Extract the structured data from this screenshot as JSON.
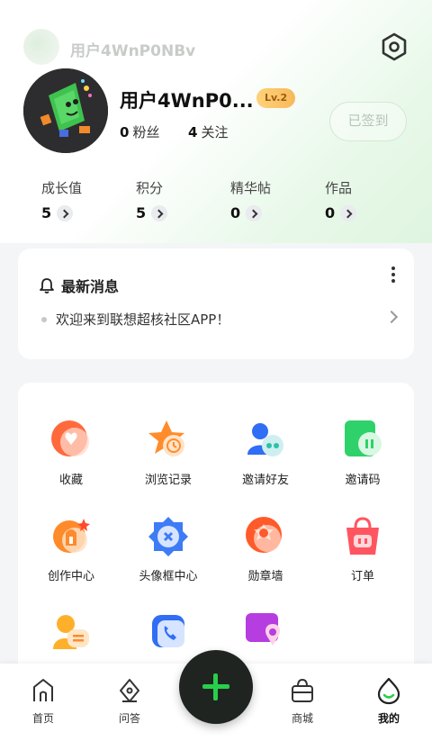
{
  "header": {
    "mini_name": "用户4WnP0NBv",
    "settings_icon": "hex-settings-icon"
  },
  "profile": {
    "username": "用户4WnP0...",
    "level": "Lv.2",
    "fans_count": "0",
    "fans_label": "粉丝",
    "follow_count": "4",
    "follow_label": "关注",
    "checkin_label": "已签到"
  },
  "growth": [
    {
      "label": "成长值",
      "value": "5"
    },
    {
      "label": "积分",
      "value": "5"
    },
    {
      "label": "精华帖",
      "value": "0"
    },
    {
      "label": "作品",
      "value": "0"
    }
  ],
  "news": {
    "title": "最新消息",
    "message": "欢迎来到联想超核社区APP！"
  },
  "features": [
    {
      "label": "收藏",
      "icon": "heart-icon"
    },
    {
      "label": "浏览记录",
      "icon": "history-icon"
    },
    {
      "label": "邀请好友",
      "icon": "invite-friend-icon"
    },
    {
      "label": "邀请码",
      "icon": "invite-code-icon"
    },
    {
      "label": "创作中心",
      "icon": "creation-icon"
    },
    {
      "label": "头像框中心",
      "icon": "avatar-frame-icon"
    },
    {
      "label": "勋章墙",
      "icon": "medal-icon"
    },
    {
      "label": "订单",
      "icon": "order-bag-icon"
    },
    {
      "label": "",
      "icon": "feedback-icon"
    },
    {
      "label": "",
      "icon": "phone-icon"
    },
    {
      "label": "",
      "icon": "location-icon"
    }
  ],
  "tabbar": {
    "home": "首页",
    "qa": "问答",
    "mall": "商城",
    "mine": "我的"
  },
  "colors": {
    "accent": "#27d04b",
    "fab_bg": "#1f2420",
    "badge": "#f7b95a"
  }
}
